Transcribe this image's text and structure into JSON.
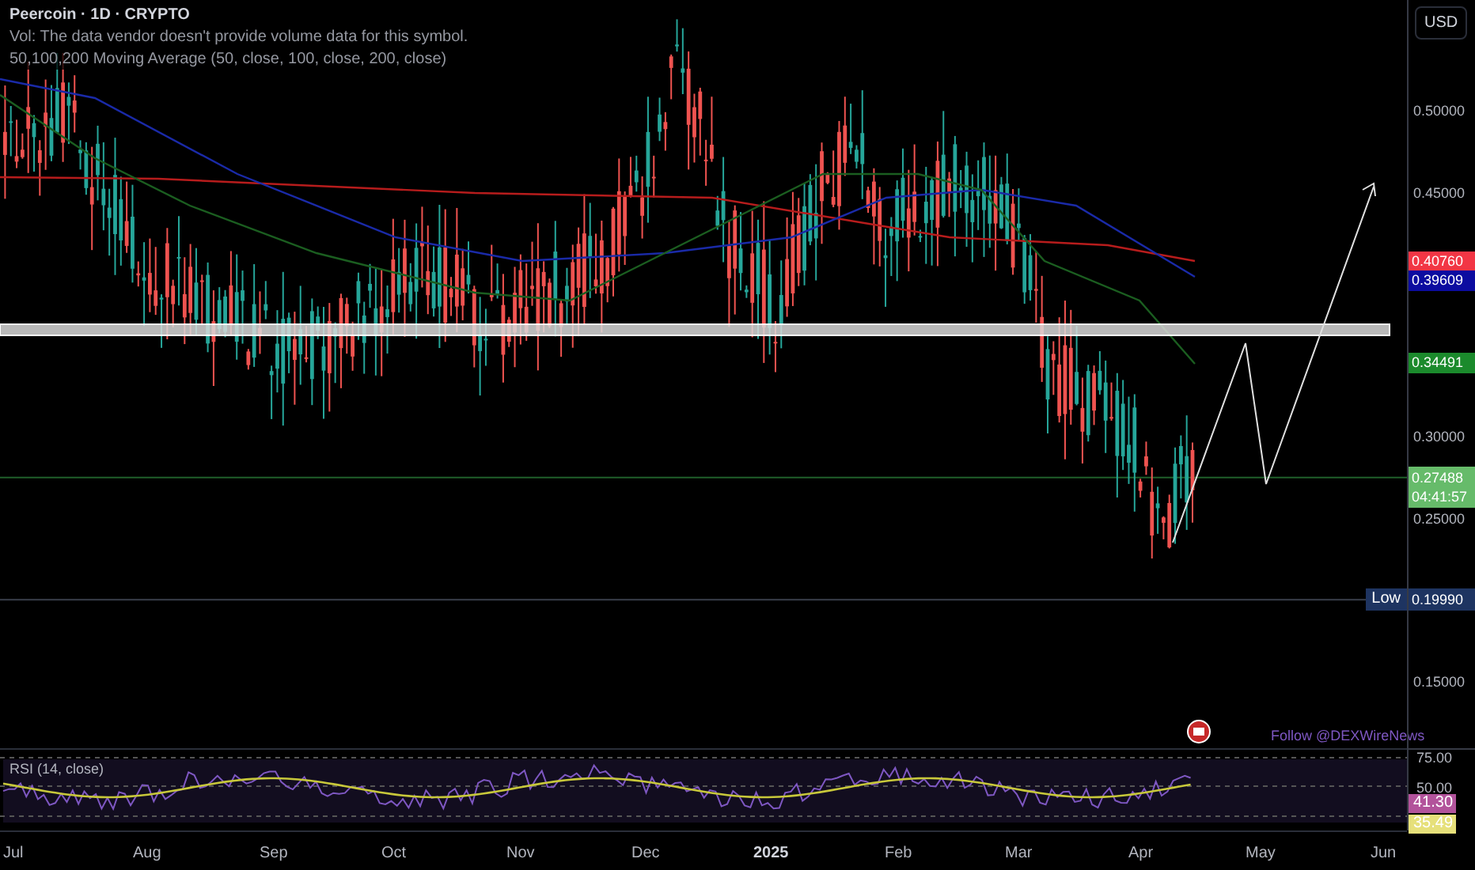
{
  "chart": {
    "title": "Peercoin · 1D · CRYPTO",
    "legend": [
      "Vol: The data vendor doesn't provide volume data for this symbol.",
      "50,100,200 Moving Average (50, close, 100, close, 200, close)"
    ],
    "currency": "USD",
    "price_ticks": [
      "0.50000",
      "0.45000",
      "0.30000",
      "0.25000",
      "0.15000"
    ],
    "price_labels": [
      {
        "text": "0.40760",
        "color": "#f23645"
      },
      {
        "text": "0.39609",
        "color": "#0c0ca0"
      },
      {
        "text": "0.34491",
        "color": "#1b8a2c"
      }
    ],
    "current_price": {
      "price": "0.27488",
      "countdown": "04:41:57"
    },
    "low": {
      "label": "Low",
      "price": "0.19990"
    },
    "annotation": "Follow @DEXWireNews"
  },
  "rsi": {
    "title": "RSI (14, close)",
    "ticks": [
      "75.00",
      "50.00"
    ],
    "labels": [
      {
        "text": "41.30",
        "color": "#b2539b"
      },
      {
        "text": "35.49",
        "color": "#e6e07a"
      }
    ]
  },
  "time_axis": [
    {
      "label": "Jul",
      "bold": false
    },
    {
      "label": "Aug",
      "bold": false
    },
    {
      "label": "Sep",
      "bold": false
    },
    {
      "label": "Oct",
      "bold": false
    },
    {
      "label": "Nov",
      "bold": false
    },
    {
      "label": "Dec",
      "bold": false
    },
    {
      "label": "2025",
      "bold": true
    },
    {
      "label": "Feb",
      "bold": false
    },
    {
      "label": "Mar",
      "bold": false
    },
    {
      "label": "Apr",
      "bold": false
    },
    {
      "label": "May",
      "bold": false
    },
    {
      "label": "Jun",
      "bold": false
    }
  ]
}
